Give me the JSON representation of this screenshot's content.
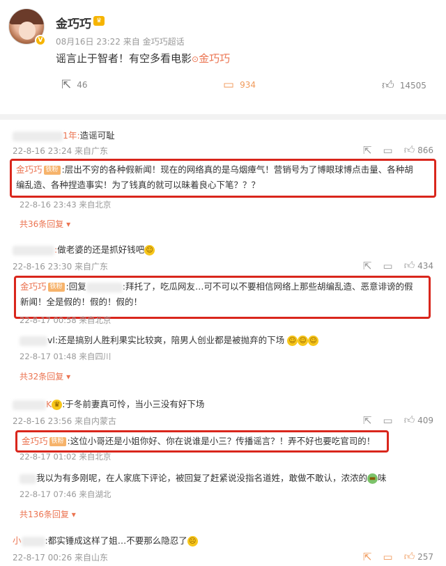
{
  "post": {
    "author": "金巧巧",
    "meta": "08月16日 23:22  来自 金巧巧超话",
    "text_main": "谣言止于智者！有空多看电影",
    "text_link": "金巧巧",
    "actions": {
      "repost": "46",
      "comment": "934",
      "like": "14505"
    }
  },
  "comments": [
    {
      "user_suffix": "1年:",
      "text": "造谣可耻",
      "meta": "22-8-16 23:24 来自广东",
      "like": "866",
      "reply": {
        "user": "金巧巧",
        "badge": "铁粉",
        "line1": ":层出不穷的各种假新闻！现在的网络真的是乌烟瘴气！营销号为了博眼球博点击量、各种胡",
        "line2": "编乱造、各种捏造事实！为了钱真的就可以昧着良心下笔？？？",
        "meta": "22-8-16 23:43 来自北京"
      },
      "more": "共36条回复 ▾"
    },
    {
      "user_suffix": ":",
      "text": "做老婆的还是抓好钱吧",
      "meta": "22-8-16 23:30 来自广东",
      "like": "434",
      "reply": {
        "user": "金巧巧",
        "badge": "铁粉",
        "line1_a": ":回复",
        "line1_b": ":拜托了，吃瓜网友…可不可以不要相信网络上那些胡编乱造、恶意诽谤的假",
        "line2": "新闻！全是假的！假的！假的！",
        "meta": "22-8-17 00:58 来自北京"
      },
      "sub": {
        "user_suffix": "vl:",
        "text": "还是搞别人胜利果实比较爽，陪男人创业都是被抛弃的下场",
        "meta": "22-8-17 01:48 来自四川"
      },
      "more": "共32条回复 ▾"
    },
    {
      "user_suffix": "K",
      "text": ":于冬前妻真可怜，当小三没有好下场",
      "meta": "22-8-16 23:56 来自内蒙古",
      "like": "409",
      "reply": {
        "user": "金巧巧",
        "badge": "铁粉",
        "line1": ":这位小哥还是小姐你好、你在说谁是小三？传播谣言？！弄不好也要吃官司的！",
        "meta": "22-8-17 01:02 来自北京"
      },
      "sub": {
        "text": "我以为有多刚呢，在人家底下评论，被回复了赶紧说没指名道姓，敢做不敢认，浓浓的",
        "text_end": "味",
        "meta": "22-8-17 07:46 来自湖北"
      },
      "more": "共136条回复 ▾"
    },
    {
      "user_prefix": "小",
      "text": ":都实锤成这样了姐…不要那么隐忍了",
      "meta": "22-8-17 00:26 来自山东",
      "like": "257"
    }
  ],
  "icons": {
    "repost": "share-icon",
    "comment": "comment-icon",
    "like": "thumbs-up-icon"
  },
  "colors": {
    "accent": "#eb7350",
    "highlight_box": "#d9261c",
    "badge": "#f6b400"
  }
}
